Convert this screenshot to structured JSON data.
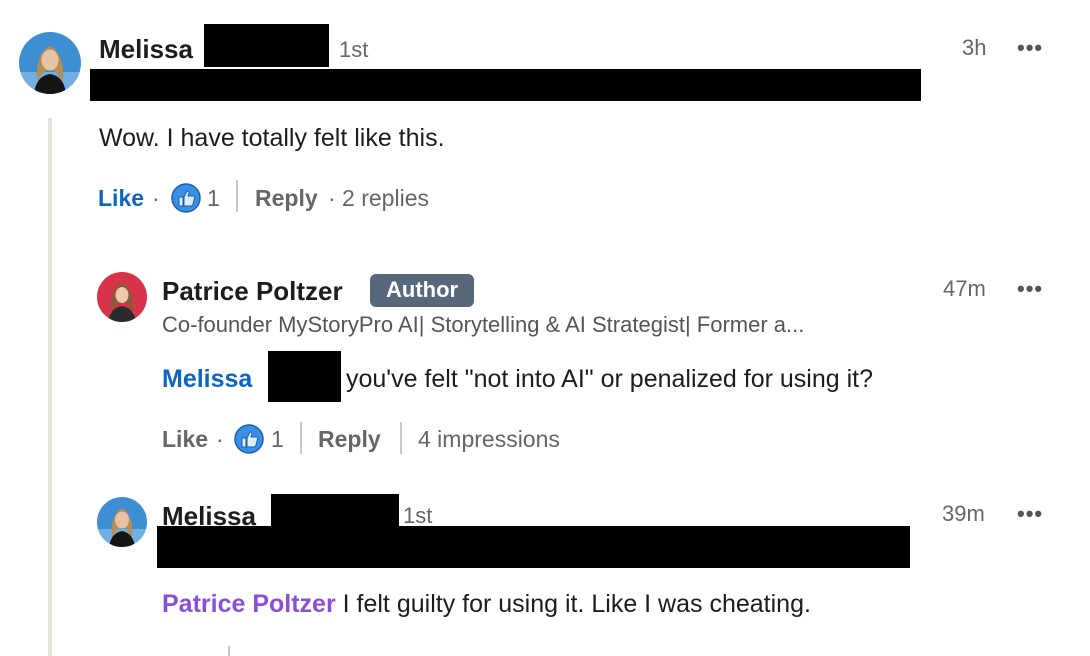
{
  "thread": {
    "comment": {
      "author": "Melissa",
      "degree": "1st",
      "time": "3h",
      "more": "•••",
      "text": "Wow. I have totally felt like this.",
      "actions": {
        "like": "Like",
        "sep": "·",
        "reaction_count": "1",
        "reply": "Reply",
        "replies": "· 2 replies"
      }
    },
    "reply1": {
      "author": "Patrice Poltzer",
      "badge": "Author",
      "headline": "Co-founder MyStoryPro AI| Storytelling & AI Strategist| Former a...",
      "time": "47m",
      "more": "•••",
      "mention": "Melissa",
      "text": "you've felt \"not into AI\" or penalized for using it?",
      "actions": {
        "like": "Like",
        "sep": "·",
        "reaction_count": "1",
        "reply": "Reply",
        "impressions": "4 impressions"
      }
    },
    "reply2": {
      "author": "Melissa",
      "degree": "1st",
      "time": "39m",
      "more": "•••",
      "mention": "Patrice Poltzer",
      "text": "I felt guilty for using it. Like I was cheating."
    }
  },
  "colors": {
    "link_blue": "#0a66c2",
    "mention_purple": "#8a4fd6",
    "badge_bg": "#56687a",
    "thread_line": "#e7e2db"
  }
}
